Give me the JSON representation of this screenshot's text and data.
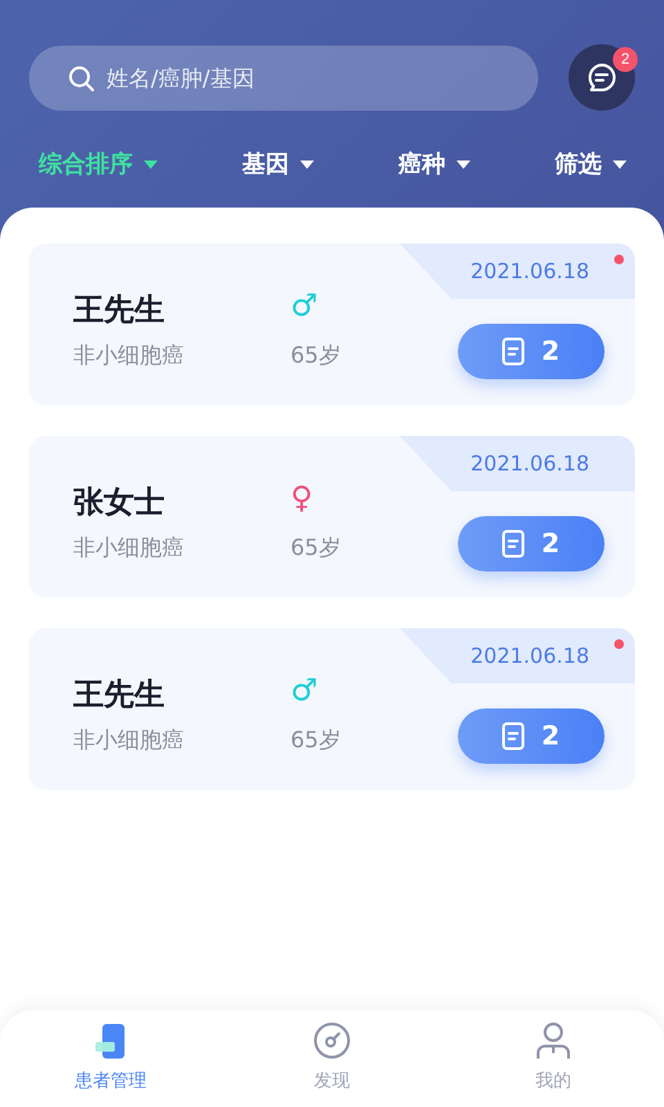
{
  "search": {
    "placeholder": "姓名/癌肿/基因"
  },
  "messages": {
    "badge": "2"
  },
  "filters": [
    {
      "label": "综合排序",
      "selected": true
    },
    {
      "label": "基因",
      "selected": false
    },
    {
      "label": "癌种",
      "selected": false
    },
    {
      "label": "筛选",
      "selected": false
    }
  ],
  "patients": [
    {
      "name": "王先生",
      "kind": "male",
      "gender_symbol": "♂",
      "diagnosis": "非小细胞癌",
      "age": "65岁",
      "date": "2021.06.18",
      "unread": true,
      "reports": "2"
    },
    {
      "name": "张女士",
      "kind": "female",
      "gender_symbol": "♀",
      "diagnosis": "非小细胞癌",
      "age": "65岁",
      "date": "2021.06.18",
      "unread": false,
      "reports": "2"
    },
    {
      "name": "王先生",
      "kind": "male",
      "gender_symbol": "♂",
      "diagnosis": "非小细胞癌",
      "age": "65岁",
      "date": "2021.06.18",
      "unread": true,
      "reports": "2"
    }
  ],
  "tabs": [
    {
      "label": "患者管理",
      "kind": "patients",
      "selected": true
    },
    {
      "label": "发现",
      "kind": "discover",
      "selected": false
    },
    {
      "label": "我的",
      "kind": "profile",
      "selected": false
    }
  ]
}
